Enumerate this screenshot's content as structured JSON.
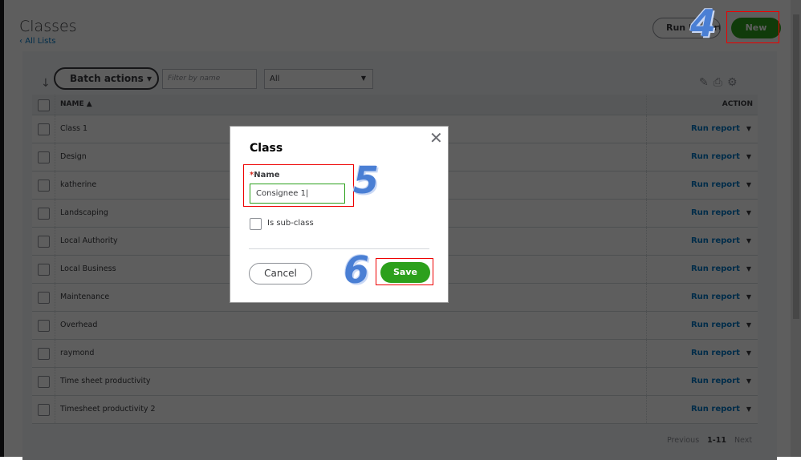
{
  "page": {
    "title": "Classes",
    "back_link": "All Lists",
    "run_report": "Run Report",
    "new": "New"
  },
  "toolbar": {
    "batch_actions": "Batch actions",
    "filter_placeholder": "Filter by name",
    "status_select": "All"
  },
  "table": {
    "headers": {
      "name": "NAME ▲",
      "action": "ACTION"
    },
    "rows": [
      {
        "name": "Class 1",
        "action": "Run report"
      },
      {
        "name": "Design",
        "action": "Run report"
      },
      {
        "name": "katherine",
        "action": "Run report"
      },
      {
        "name": "Landscaping",
        "action": "Run report"
      },
      {
        "name": "Local Authority",
        "action": "Run report"
      },
      {
        "name": "Local Business",
        "action": "Run report"
      },
      {
        "name": "Maintenance",
        "action": "Run report"
      },
      {
        "name": "Overhead",
        "action": "Run report"
      },
      {
        "name": "raymond",
        "action": "Run report"
      },
      {
        "name": "Time sheet productivity",
        "action": "Run report"
      },
      {
        "name": "Timesheet productivity 2",
        "action": "Run report"
      }
    ]
  },
  "pager": {
    "previous": "Previous",
    "range": "1-11",
    "next": "Next"
  },
  "dialog": {
    "title": "Class",
    "name_label": "Name",
    "name_value": "Consignee 1",
    "subclass_label": "Is sub-class",
    "cancel": "Cancel",
    "save": "Save"
  },
  "annotations": {
    "step4": "4",
    "step5": "5",
    "step6": "6"
  }
}
